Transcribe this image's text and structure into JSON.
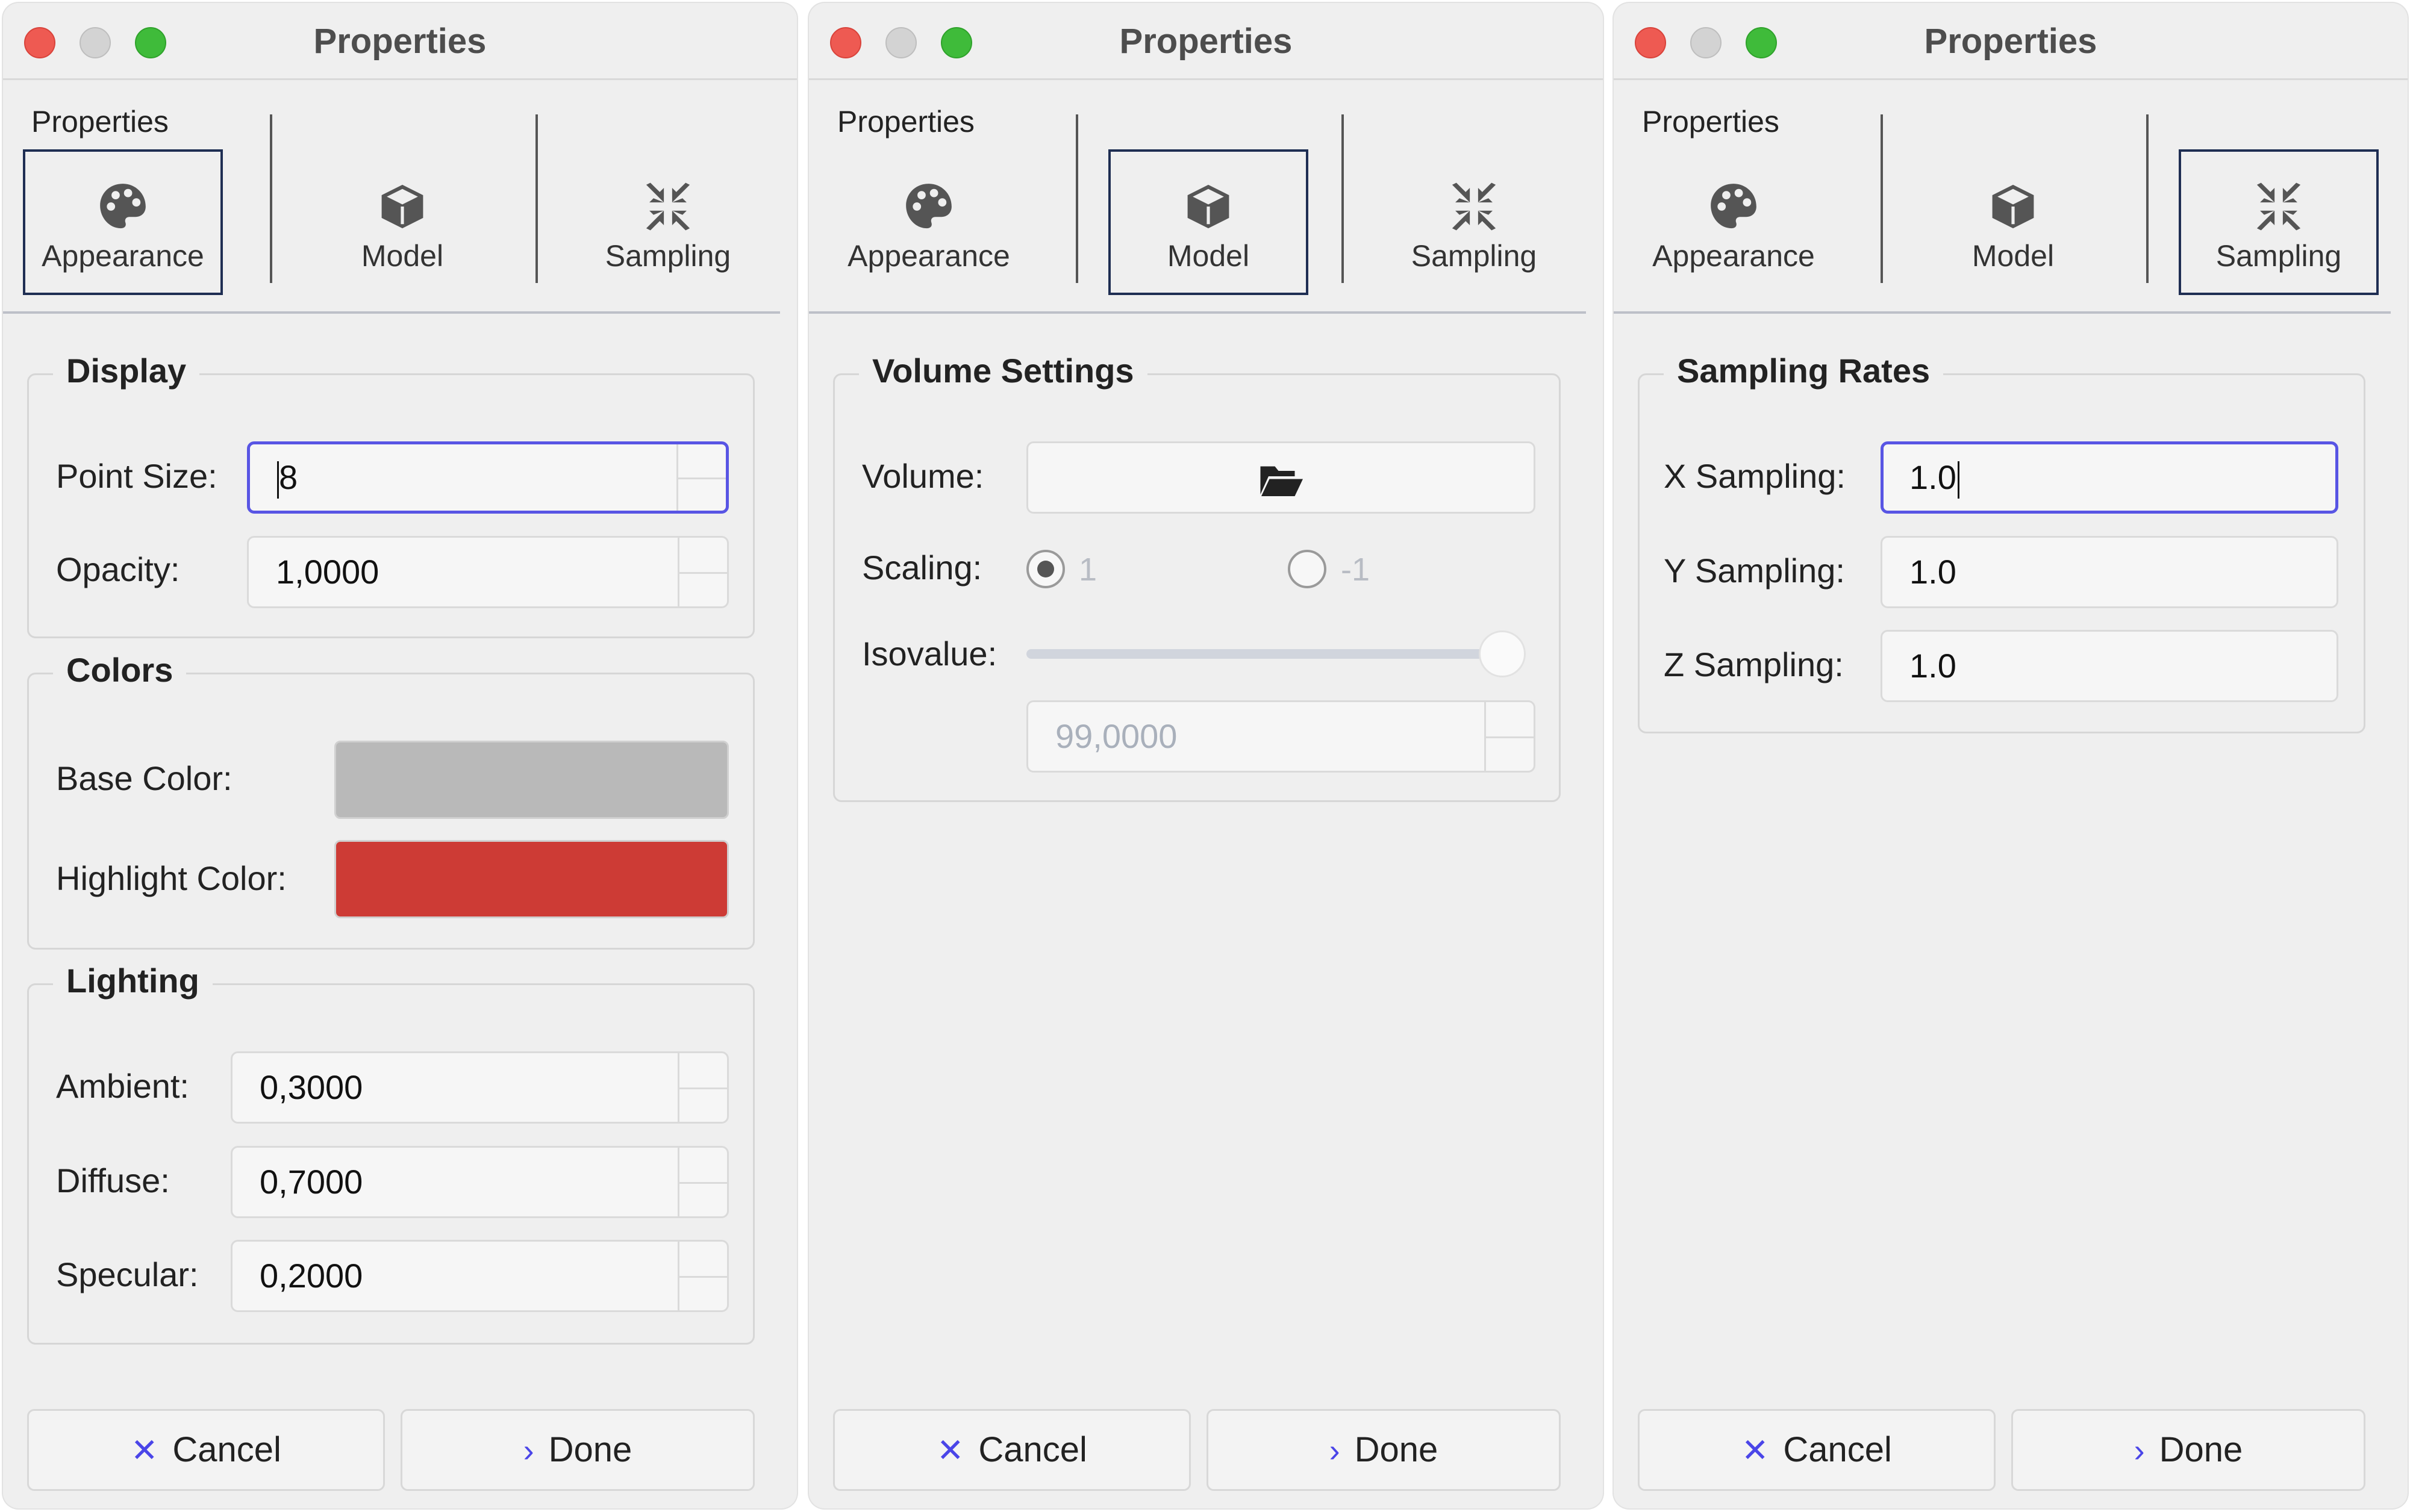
{
  "window_title": "Properties",
  "toolbar": {
    "label": "Properties",
    "tabs": [
      "Appearance",
      "Model",
      "Sampling"
    ]
  },
  "appearance": {
    "display": {
      "title": "Display",
      "point_size_label": "Point Size:",
      "point_size_value": "8",
      "opacity_label": "Opacity:",
      "opacity_value": "1,0000"
    },
    "colors": {
      "title": "Colors",
      "base_label": "Base Color:",
      "base_color": "#b9b9b9",
      "highlight_label": "Highlight Color:",
      "highlight_color": "#cd3b35"
    },
    "lighting": {
      "title": "Lighting",
      "ambient_label": "Ambient:",
      "ambient_value": "0,3000",
      "diffuse_label": "Diffuse:",
      "diffuse_value": "0,7000",
      "specular_label": "Specular:",
      "specular_value": "0,2000"
    }
  },
  "model": {
    "title": "Volume Settings",
    "volume_label": "Volume:",
    "volume_button_icon": "folder-open-icon",
    "scaling_label": "Scaling:",
    "scaling_options": [
      "1",
      "-1"
    ],
    "scaling_selected": "1",
    "isovalue_label": "Isovalue:",
    "isovalue_slider_fraction": 1.0,
    "isovalue_value": "99,0000"
  },
  "sampling": {
    "title": "Sampling Rates",
    "x_label": "X Sampling:",
    "x_value": "1.0",
    "y_label": "Y Sampling:",
    "y_value": "1.0",
    "z_label": "Z Sampling:",
    "z_value": "1.0"
  },
  "buttons": {
    "cancel_label": "Cancel",
    "cancel_icon": "close-icon",
    "done_label": "Done",
    "done_icon": "chevron-right-icon"
  },
  "accent_color": "#5855e4",
  "active_tab_border_color": "#1f2e53"
}
